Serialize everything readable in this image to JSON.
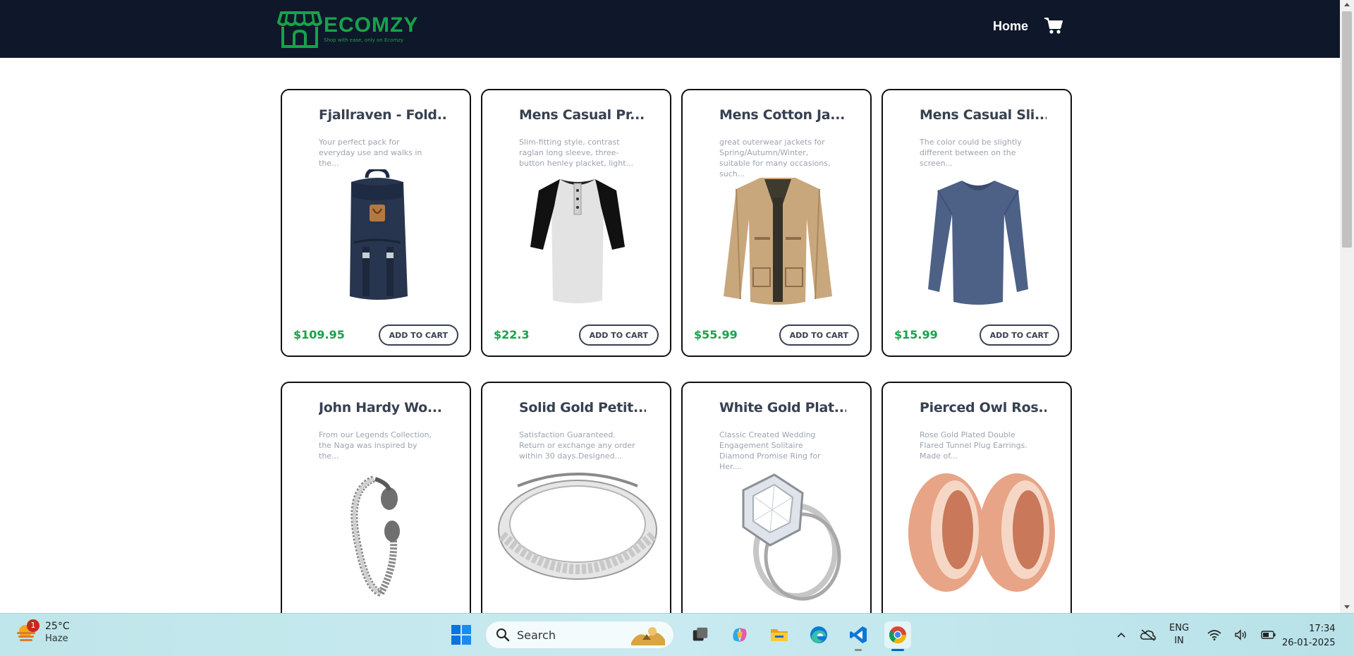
{
  "site": {
    "brand": "ECOMZY",
    "tagline": "Shop with ease, only on Ecomzy",
    "nav_home": "Home",
    "accent_color": "#16a34a",
    "nav_bg": "#0f172a"
  },
  "products": [
    {
      "title": "Fjallraven - Fold...",
      "desc": "Your perfect pack for everyday use and walks in the...",
      "price": "$109.95",
      "button": "ADD TO CART",
      "image": "backpack"
    },
    {
      "title": "Mens Casual Pr...",
      "desc": "Slim-fitting style, contrast raglan long sleeve, three-button henley placket, light...",
      "price": "$22.3",
      "button": "ADD TO CART",
      "image": "raglan-shirt"
    },
    {
      "title": "Mens Cotton Ja...",
      "desc": "great outerwear jackets for Spring/Autumn/Winter, suitable for many occasions, such...",
      "price": "$55.99",
      "button": "ADD TO CART",
      "image": "jacket"
    },
    {
      "title": "Mens Casual Sli...",
      "desc": "The color could be slightly different between on the screen...",
      "price": "$15.99",
      "button": "ADD TO CART",
      "image": "long-sleeve-tee"
    },
    {
      "title": "John Hardy Wo...",
      "desc": "From our Legends Collection, the Naga was inspired by the...",
      "price": "",
      "button": "",
      "image": "bracelet"
    },
    {
      "title": "Solid Gold Petit...",
      "desc": "Satisfaction Guaranteed. Return or exchange any order within 30 days.Designed...",
      "price": "",
      "button": "",
      "image": "silver-ring"
    },
    {
      "title": "White Gold Plat...",
      "desc": "Classic Created Wedding Engagement Solitaire Diamond Promise Ring for Her....",
      "price": "",
      "button": "",
      "image": "diamond-ring"
    },
    {
      "title": "Pierced Owl Ros...",
      "desc": "Rose Gold Plated Double Flared Tunnel Plug Earrings. Made of...",
      "price": "",
      "button": "",
      "image": "plug-earrings"
    }
  ],
  "taskbar": {
    "weather_temp": "25°C",
    "weather_cond": "Haze",
    "weather_badge": "1",
    "search_label": "Search",
    "lang_top": "ENG",
    "lang_bottom": "IN",
    "time": "17:34",
    "date": "26-01-2025"
  }
}
